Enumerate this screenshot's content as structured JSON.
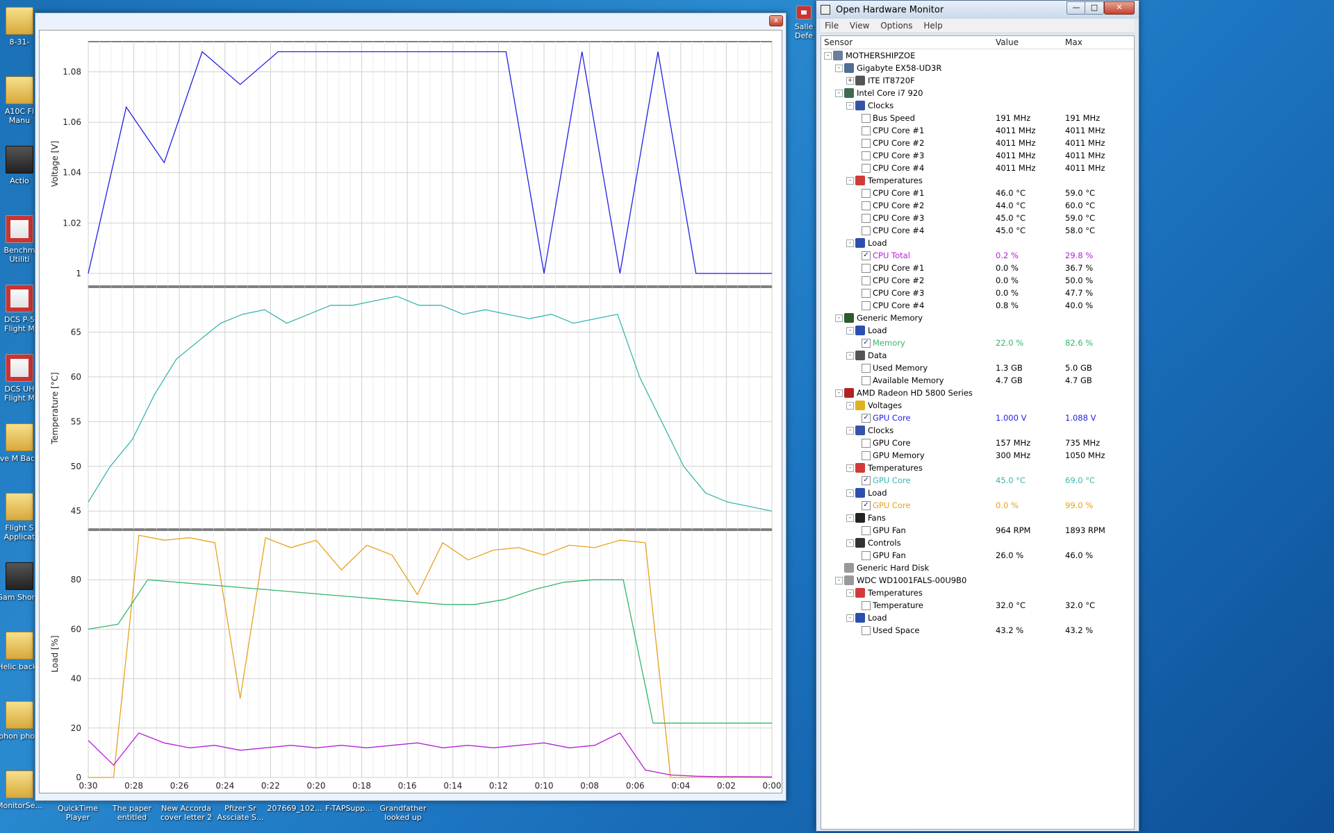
{
  "desktop": {
    "icons": [
      {
        "label": "8-31-"
      },
      {
        "label": "A10C Fl Manu"
      },
      {
        "label": "Actio"
      },
      {
        "label": "Benchm Utiliti"
      },
      {
        "label": "DCS P-5 Flight M"
      },
      {
        "label": "DCS UH Flight M"
      },
      {
        "label": "Eve M Backu"
      },
      {
        "label": "Flight S Applicat"
      },
      {
        "label": "Gam Shortc"
      },
      {
        "label": "Helic backu"
      },
      {
        "label": "Iphon photo"
      },
      {
        "label": "MonitorSe..."
      }
    ],
    "bottom_labels": [
      "QuickTime Player",
      "The paper entitled",
      "New Accorda cover letter 2",
      "Pfizer Sr Assciate S...",
      "207669_102...",
      "F-TAPSupp...",
      "Grandfather looked up"
    ],
    "right_icon_label": "Salle Defe"
  },
  "plot": {
    "close_label": "x",
    "x_ticks": [
      "0:30",
      "0:28",
      "0:26",
      "0:24",
      "0:22",
      "0:20",
      "0:18",
      "0:16",
      "0:14",
      "0:12",
      "0:10",
      "0:08",
      "0:06",
      "0:04",
      "0:02",
      "0:00"
    ],
    "panels": [
      {
        "ylabel": "Voltage [V]",
        "ticks": [
          "1.08",
          "1.06",
          "1.04",
          "1.02",
          "1"
        ]
      },
      {
        "ylabel": "Temperature [°C]",
        "ticks": [
          "65",
          "60",
          "55",
          "50",
          "45"
        ]
      },
      {
        "ylabel": "Load [%]",
        "ticks": [
          "80",
          "60",
          "40",
          "20",
          "0"
        ]
      }
    ],
    "series_colors": {
      "voltage": "#1e1ee6",
      "temperature": "#39b6ad",
      "gpu_load": "#e6a11e",
      "memory": "#33b56b",
      "cpu_total": "#b31ed6"
    }
  },
  "chart_data": [
    {
      "type": "line",
      "ylabel": "Voltage [V]",
      "x_range": [
        "0:30",
        "0:00"
      ],
      "ylim": [
        0.995,
        1.092
      ],
      "series": [
        {
          "name": "GPU Core",
          "values": [
            1.0,
            1.066,
            1.044,
            1.088,
            1.075,
            1.088,
            1.088,
            1.088,
            1.088,
            1.088,
            1.088,
            1.088,
            1.0,
            1.088,
            1.0,
            1.088,
            1.0,
            1.0,
            1.0
          ]
        }
      ]
    },
    {
      "type": "line",
      "ylabel": "Temperature [°C]",
      "x_range": [
        "0:30",
        "0:00"
      ],
      "ylim": [
        43,
        70
      ],
      "series": [
        {
          "name": "GPU Core",
          "values": [
            46,
            50,
            53,
            58,
            62,
            64,
            66,
            67,
            67.5,
            66,
            67,
            68,
            68,
            68.5,
            69,
            68,
            68,
            67,
            67.5,
            67,
            66.5,
            67,
            66,
            66.5,
            67,
            60,
            55,
            50,
            47,
            46,
            45.5,
            45
          ]
        }
      ]
    },
    {
      "type": "line",
      "ylabel": "Load [%]",
      "x_range": [
        "0:30",
        "0:00"
      ],
      "ylim": [
        0,
        100
      ],
      "series": [
        {
          "name": "GPU Core",
          "values": [
            0,
            0,
            98,
            96,
            97,
            95,
            32,
            97,
            93,
            96,
            84,
            94,
            90,
            74,
            95,
            88,
            92,
            93,
            90,
            94,
            93,
            96,
            95,
            0,
            0,
            0,
            0,
            0
          ]
        },
        {
          "name": "Memory",
          "values": [
            60,
            62,
            80,
            79,
            78,
            77,
            76,
            75,
            74,
            73,
            72,
            71,
            70,
            70,
            72,
            76,
            79,
            80,
            80,
            22,
            22,
            22,
            22,
            22
          ]
        },
        {
          "name": "CPU Total",
          "values": [
            15,
            5,
            18,
            14,
            12,
            13,
            11,
            12,
            13,
            12,
            13,
            12,
            13,
            14,
            12,
            13,
            12,
            13,
            14,
            12,
            13,
            18,
            3,
            1,
            0.5,
            0.3,
            0.3,
            0.2
          ]
        }
      ]
    }
  ],
  "ohm": {
    "title": "Open Hardware Monitor",
    "window_buttons": {
      "minimize": "—",
      "maximize": "□",
      "close": "✕"
    },
    "menu": [
      "File",
      "View",
      "Options",
      "Help"
    ],
    "columns": {
      "sensor": "Sensor",
      "value": "Value",
      "max": "Max"
    },
    "rows": [
      {
        "level": 0,
        "exp": "-",
        "icon": "computer-icon",
        "name": "MOTHERSHIPZOE"
      },
      {
        "level": 1,
        "exp": "-",
        "icon": "motherboard-icon",
        "name": "Gigabyte EX58-UD3R"
      },
      {
        "level": 2,
        "exp": "+",
        "icon": "chip-icon",
        "name": "ITE IT8720F"
      },
      {
        "level": 1,
        "exp": "-",
        "icon": "cpu-icon",
        "name": "Intel Core i7 920"
      },
      {
        "level": 2,
        "exp": "-",
        "icon": "clock-icon",
        "name": "Clocks"
      },
      {
        "level": 3,
        "chk": false,
        "name": "Bus Speed",
        "value": "191 MHz",
        "max": "191 MHz"
      },
      {
        "level": 3,
        "chk": false,
        "name": "CPU Core #1",
        "value": "4011 MHz",
        "max": "4011 MHz"
      },
      {
        "level": 3,
        "chk": false,
        "name": "CPU Core #2",
        "value": "4011 MHz",
        "max": "4011 MHz"
      },
      {
        "level": 3,
        "chk": false,
        "name": "CPU Core #3",
        "value": "4011 MHz",
        "max": "4011 MHz"
      },
      {
        "level": 3,
        "chk": false,
        "name": "CPU Core #4",
        "value": "4011 MHz",
        "max": "4011 MHz"
      },
      {
        "level": 2,
        "exp": "-",
        "icon": "thermometer-icon",
        "name": "Temperatures"
      },
      {
        "level": 3,
        "chk": false,
        "name": "CPU Core #1",
        "value": "46.0 °C",
        "max": "59.0 °C"
      },
      {
        "level": 3,
        "chk": false,
        "name": "CPU Core #2",
        "value": "44.0 °C",
        "max": "60.0 °C"
      },
      {
        "level": 3,
        "chk": false,
        "name": "CPU Core #3",
        "value": "45.0 °C",
        "max": "59.0 °C"
      },
      {
        "level": 3,
        "chk": false,
        "name": "CPU Core #4",
        "value": "45.0 °C",
        "max": "58.0 °C"
      },
      {
        "level": 2,
        "exp": "-",
        "icon": "load-icon",
        "name": "Load"
      },
      {
        "level": 3,
        "chk": true,
        "color": "#b31ed6",
        "name": "CPU Total",
        "value": "0.2 %",
        "max": "29.8 %"
      },
      {
        "level": 3,
        "chk": false,
        "name": "CPU Core #1",
        "value": "0.0 %",
        "max": "36.7 %"
      },
      {
        "level": 3,
        "chk": false,
        "name": "CPU Core #2",
        "value": "0.0 %",
        "max": "50.0 %"
      },
      {
        "level": 3,
        "chk": false,
        "name": "CPU Core #3",
        "value": "0.0 %",
        "max": "47.7 %"
      },
      {
        "level": 3,
        "chk": false,
        "name": "CPU Core #4",
        "value": "0.8 %",
        "max": "40.0 %"
      },
      {
        "level": 1,
        "exp": "-",
        "icon": "memory-icon",
        "name": "Generic Memory"
      },
      {
        "level": 2,
        "exp": "-",
        "icon": "load-icon",
        "name": "Load"
      },
      {
        "level": 3,
        "chk": true,
        "color": "#33b56b",
        "name": "Memory",
        "value": "22.0 %",
        "max": "82.6 %"
      },
      {
        "level": 2,
        "exp": "-",
        "icon": "data-icon",
        "name": "Data"
      },
      {
        "level": 3,
        "chk": false,
        "name": "Used Memory",
        "value": "1.3 GB",
        "max": "5.0 GB"
      },
      {
        "level": 3,
        "chk": false,
        "name": "Available Memory",
        "value": "4.7 GB",
        "max": "4.7 GB"
      },
      {
        "level": 1,
        "exp": "-",
        "icon": "gpu-icon",
        "name": "AMD Radeon HD 5800 Series"
      },
      {
        "level": 2,
        "exp": "-",
        "icon": "lightning-icon",
        "name": "Voltages"
      },
      {
        "level": 3,
        "chk": true,
        "color": "#1e1ee6",
        "name": "GPU Core",
        "value": "1.000 V",
        "max": "1.088 V"
      },
      {
        "level": 2,
        "exp": "-",
        "icon": "clock-icon",
        "name": "Clocks"
      },
      {
        "level": 3,
        "chk": false,
        "name": "GPU Core",
        "value": "157 MHz",
        "max": "735 MHz"
      },
      {
        "level": 3,
        "chk": false,
        "name": "GPU Memory",
        "value": "300 MHz",
        "max": "1050 MHz"
      },
      {
        "level": 2,
        "exp": "-",
        "icon": "thermometer-icon",
        "name": "Temperatures"
      },
      {
        "level": 3,
        "chk": true,
        "color": "#39b6ad",
        "name": "GPU Core",
        "value": "45.0 °C",
        "max": "69.0 °C"
      },
      {
        "level": 2,
        "exp": "-",
        "icon": "load-icon",
        "name": "Load"
      },
      {
        "level": 3,
        "chk": true,
        "color": "#e6a11e",
        "name": "GPU Core",
        "value": "0.0 %",
        "max": "99.0 %"
      },
      {
        "level": 2,
        "exp": "-",
        "icon": "fan-icon",
        "name": "Fans"
      },
      {
        "level": 3,
        "chk": false,
        "name": "GPU Fan",
        "value": "964 RPM",
        "max": "1893 RPM"
      },
      {
        "level": 2,
        "exp": "-",
        "icon": "control-icon",
        "name": "Controls"
      },
      {
        "level": 3,
        "chk": false,
        "name": "GPU Fan",
        "value": "26.0 %",
        "max": "46.0 %"
      },
      {
        "level": 1,
        "icon": "harddisk-icon",
        "name": "Generic Hard Disk"
      },
      {
        "level": 1,
        "exp": "-",
        "icon": "harddisk-icon",
        "name": "WDC WD1001FALS-00U9B0"
      },
      {
        "level": 2,
        "exp": "-",
        "icon": "thermometer-icon",
        "name": "Temperatures"
      },
      {
        "level": 3,
        "chk": false,
        "name": "Temperature",
        "value": "32.0 °C",
        "max": "32.0 °C"
      },
      {
        "level": 2,
        "exp": "-",
        "icon": "load-icon",
        "name": "Load"
      },
      {
        "level": 3,
        "chk": false,
        "name": "Used Space",
        "value": "43.2 %",
        "max": "43.2 %"
      }
    ]
  }
}
